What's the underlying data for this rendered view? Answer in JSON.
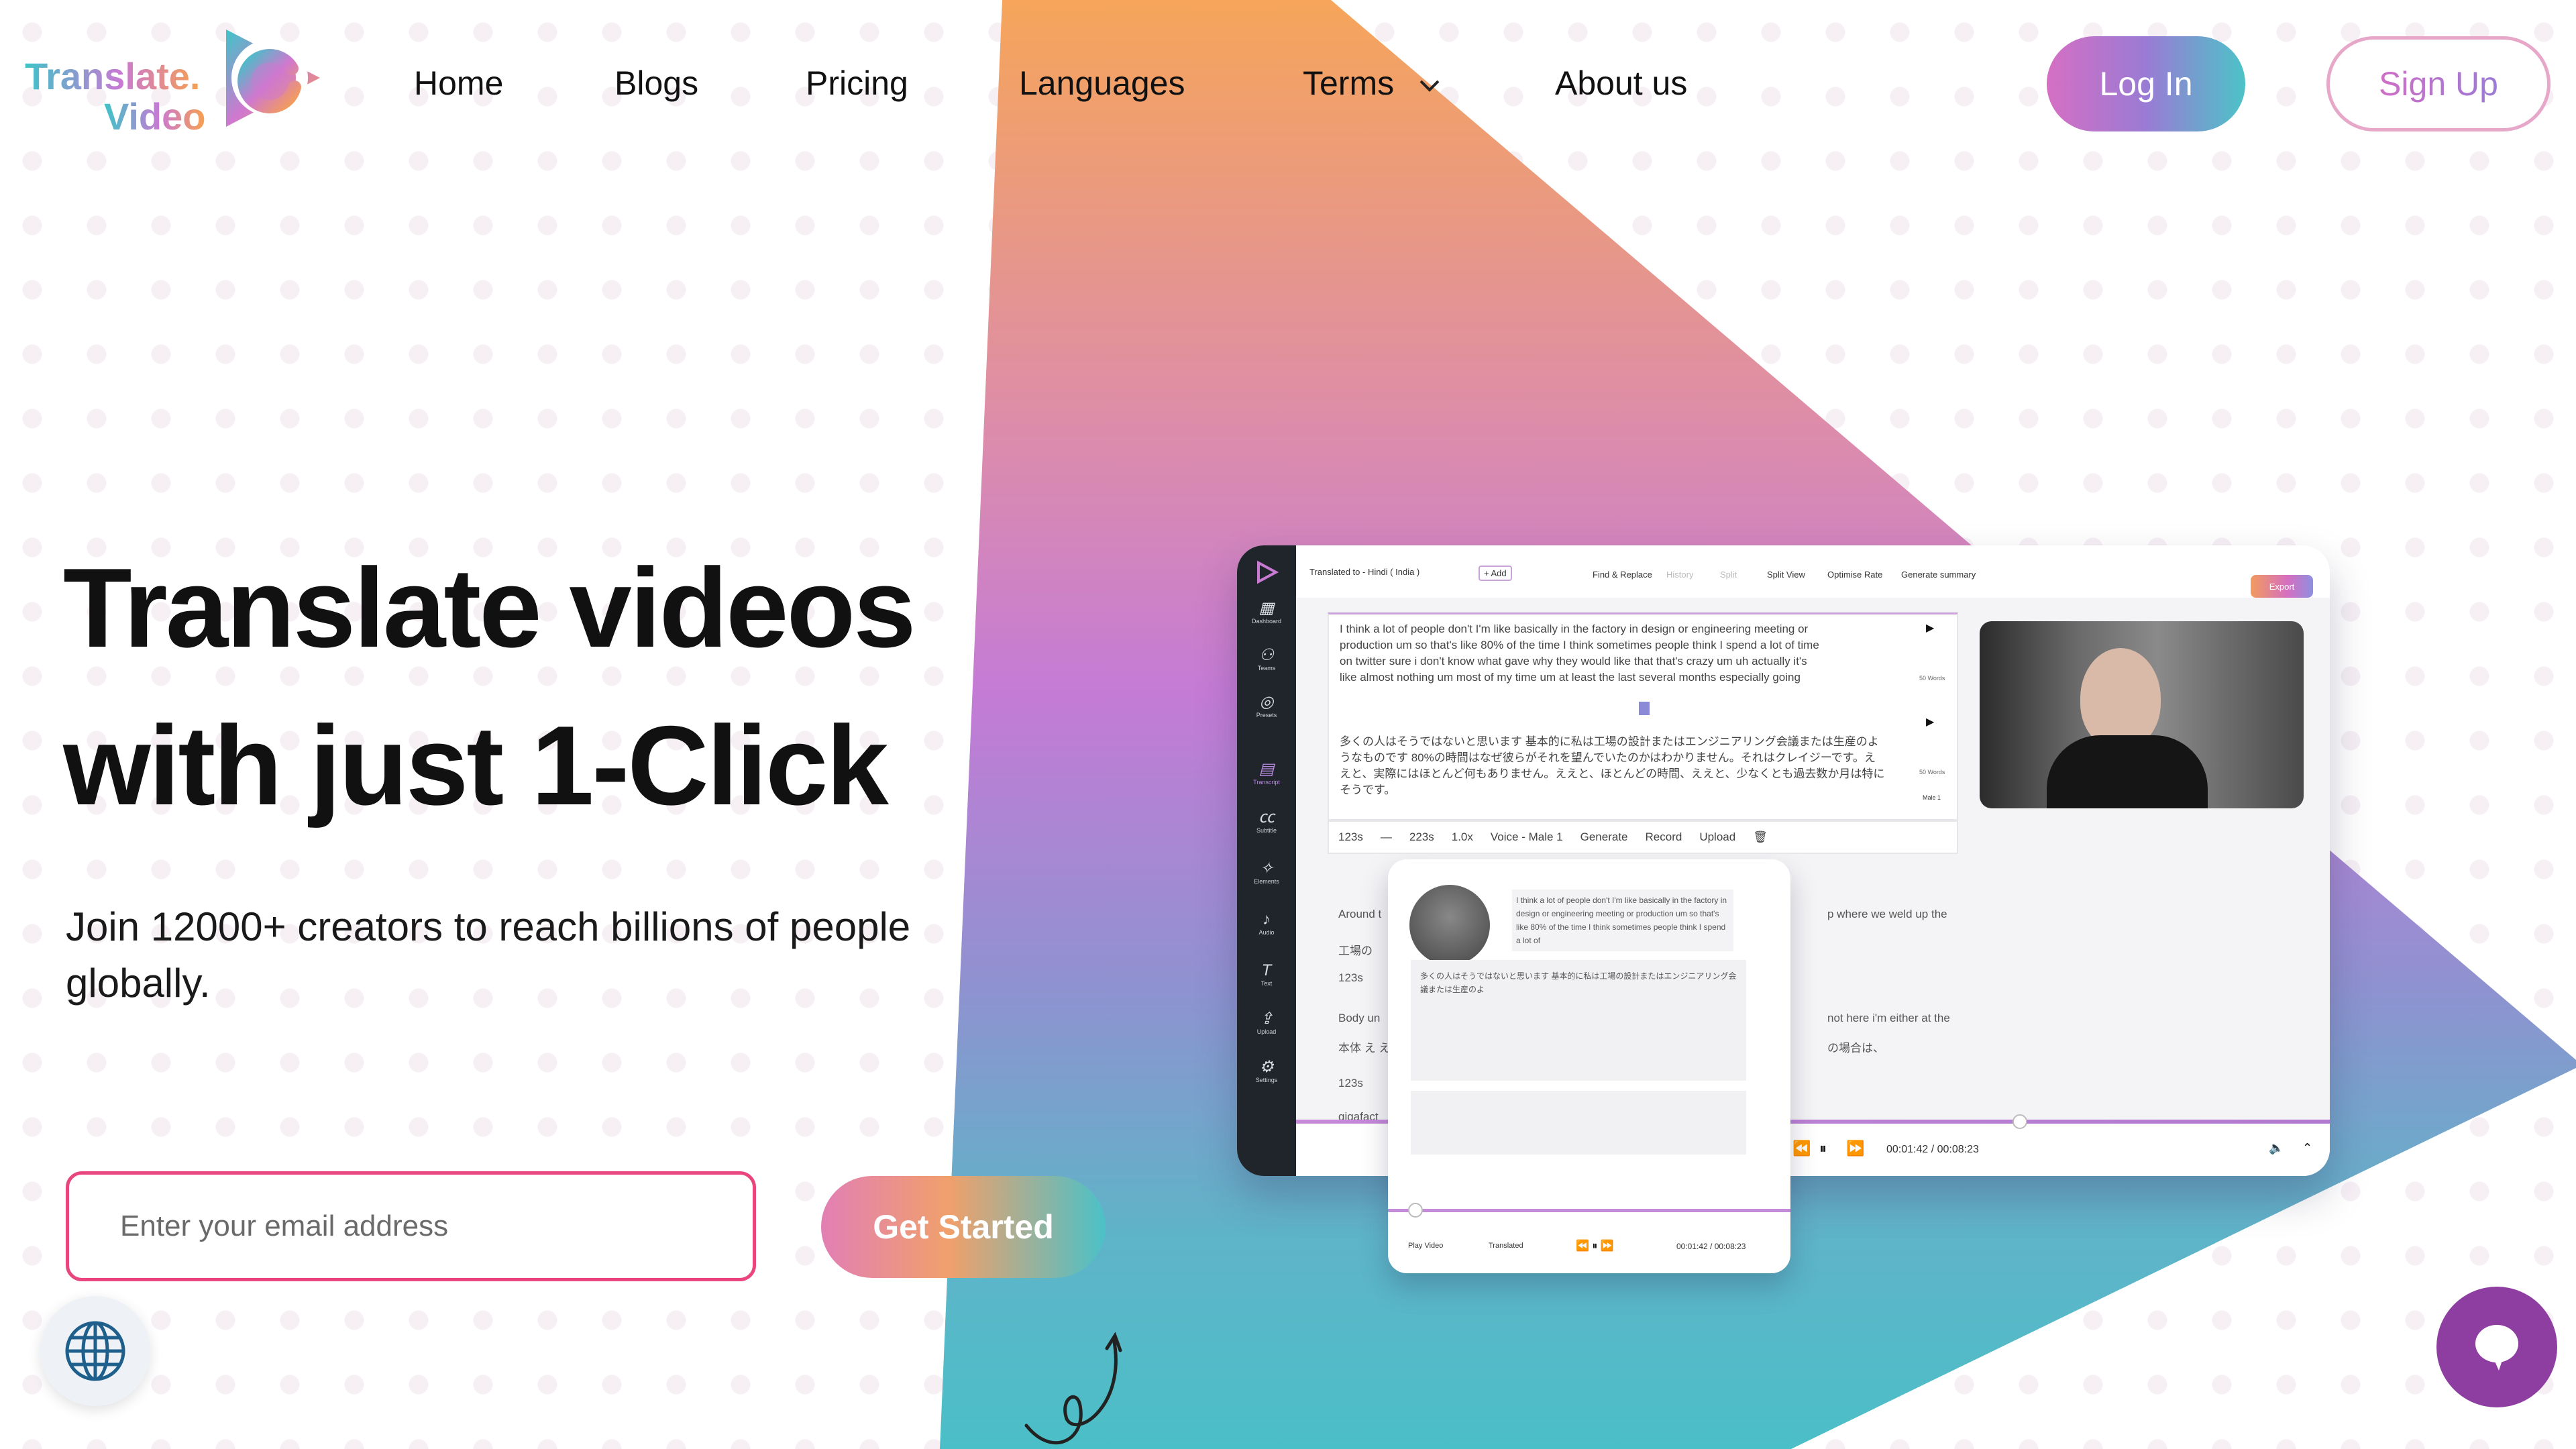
{
  "brand": {
    "logo_line1": "Translate.",
    "logo_line2": "Video"
  },
  "nav": {
    "items": [
      {
        "label": "Home"
      },
      {
        "label": "Blogs"
      },
      {
        "label": "Pricing"
      },
      {
        "label": "Languages"
      },
      {
        "label": "Terms"
      },
      {
        "label": "About us"
      }
    ],
    "login": "Log In",
    "signup": "Sign Up"
  },
  "hero": {
    "title_line1": "Translate videos",
    "title_line2": "with just 1-Click",
    "subtitle": "Join 12000+ creators to reach billions of people globally.",
    "email_placeholder": "Enter your email address",
    "cta": "Get Started"
  },
  "mockup": {
    "language": "Translated to - Hindi ( India )",
    "add": "+ Add",
    "tools": [
      "Find & Replace",
      "History",
      "Split",
      "Split View",
      "Optimise Rate",
      "Generate summary"
    ],
    "export": "Export",
    "sidebar": [
      "Dashboard",
      "Teams",
      "Presets",
      "Transcript",
      "Subtitle",
      "Elements",
      "Audio",
      "Text",
      "Upload",
      "Settings"
    ],
    "transcript_en": [
      "I think a lot of people don't I'm like basically in the factory in design or engineering meeting or",
      "production um so that's like 80% of the time I think sometimes people think I spend a lot of time",
      "on twitter sure i don't know what gave why they would like that that's crazy um uh actually it's",
      "like almost nothing um most of my time um at least the last several months especially going"
    ],
    "transcript_ja": [
      "多くの人はそうではないと思います 基本的に私は工場の設計またはエンジニアリング会議または生産のよ",
      "うなものです 80%の時間はなぜ彼らがそれを望んでいたのかはわかりません。それはクレイジーです。え",
      "えと、実際にはほとんど何もありません。ええと、ほとんどの時間、ええと、少なくとも過去数か月は特に",
      "そうです。"
    ],
    "segment_meta": [
      "50 Words",
      "50 Words",
      "Male 1"
    ],
    "toolbar": {
      "start": "123s",
      "end": "223s",
      "speed": "1.0x",
      "voice": "Voice - Male 1",
      "generate": "Generate",
      "record": "Record",
      "upload": "Upload"
    },
    "below_lines": [
      "Around t",
      "p where we weld up the",
      "工場の",
      "123s",
      "Body un",
      "not here i'm either at the",
      "本体 え え",
      "の場合は、",
      "123s",
      "gigafact"
    ],
    "time": "00:01:42 / 00:08:23",
    "timeline_progress": 0.78,
    "card": {
      "text": "I think a lot of people don't I'm like basically in the factory in design or engineering meeting or production um so that's like 80% of the time I think sometimes people think I spend a lot of",
      "play_video": "Play Video",
      "translated": "Translated",
      "time": "00:01:42 / 00:08:23",
      "progress": 0.07
    }
  },
  "colors": {
    "accent_pink": "#e9457f",
    "teal": "#4bc1c8",
    "orange": "#f6a35a",
    "purple": "#8e3ea0",
    "chat": "#8e3ea0"
  },
  "icons": {
    "globe": "globe-icon",
    "chat": "chat-bubble-icon",
    "chevron": "chevron-down-icon"
  }
}
